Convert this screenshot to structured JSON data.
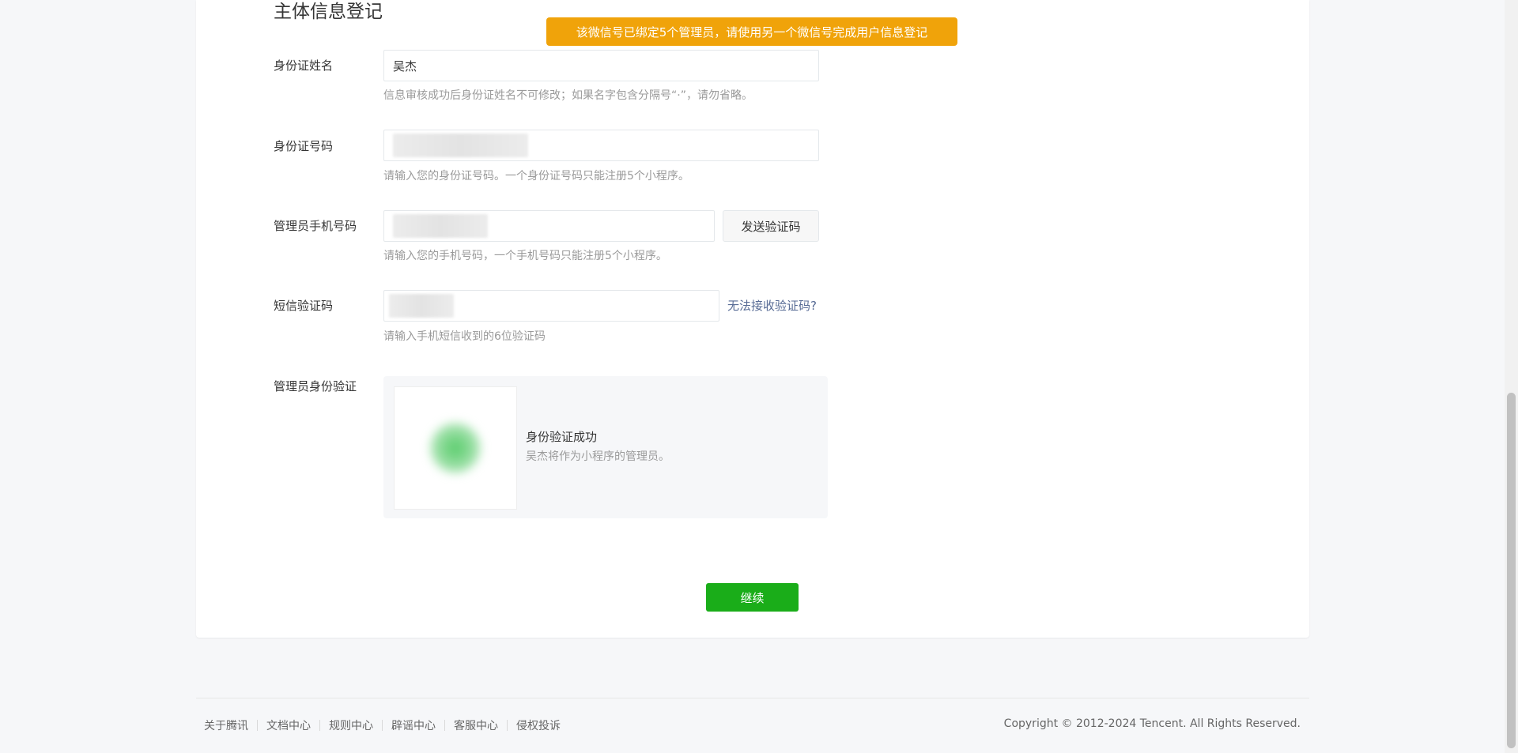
{
  "section": {
    "title": "主体信息登记"
  },
  "toast": {
    "message": "该微信号已绑定5个管理员，请使用另一个微信号完成用户信息登记"
  },
  "form": {
    "name": {
      "label": "身份证姓名",
      "value": "吴杰",
      "tip": "信息审核成功后身份证姓名不可修改；如果名字包含分隔号“·”，请勿省略。"
    },
    "id_number": {
      "label": "身份证号码",
      "tip": "请输入您的身份证号码。一个身份证号码只能注册5个小程序。"
    },
    "phone": {
      "label": "管理员手机号码",
      "send_button": "发送验证码",
      "tip": "请输入您的手机号码，一个手机号码只能注册5个小程序。"
    },
    "sms_code": {
      "label": "短信验证码",
      "help_link": "无法接收验证码?",
      "tip": "请输入手机短信收到的6位验证码"
    },
    "admin_verify": {
      "label": "管理员身份验证",
      "status_title": "身份验证成功",
      "status_desc": "吴杰将作为小程序的管理员。"
    },
    "continue_button": "继续"
  },
  "footer": {
    "links": [
      "关于腾讯",
      "文档中心",
      "规则中心",
      "辟谣中心",
      "客服中心",
      "侵权投诉"
    ],
    "copyright": "Copyright © 2012-2024 Tencent. All Rights Reserved."
  },
  "colors": {
    "toast_bg": "#f0a30a",
    "primary_button": "#1aad19",
    "link": "#576b95"
  }
}
